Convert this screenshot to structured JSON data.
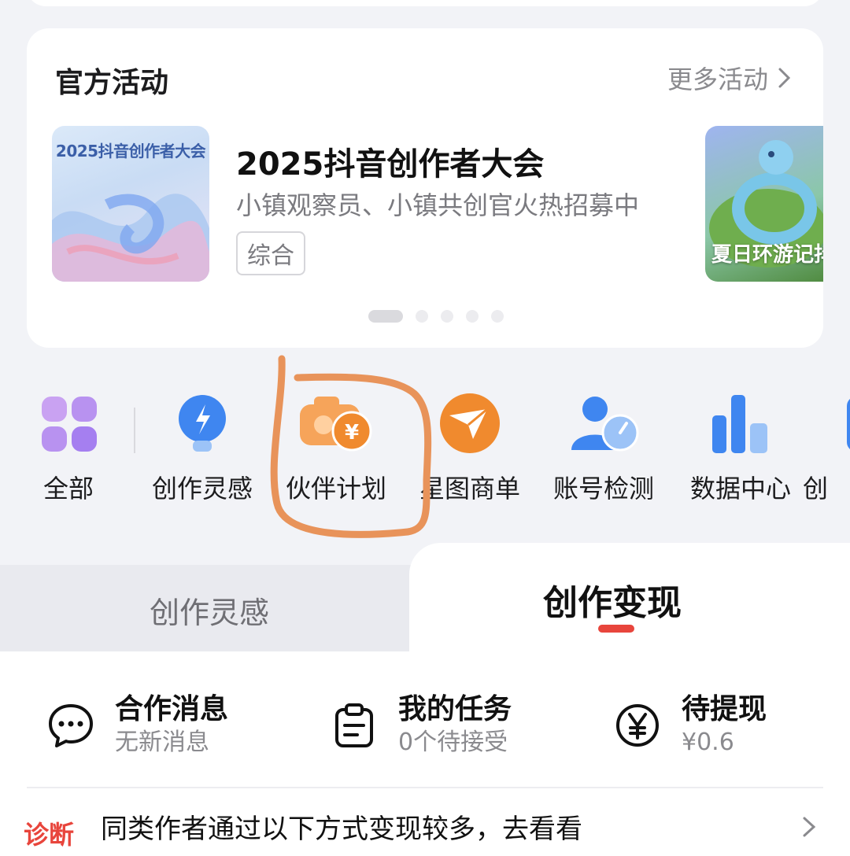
{
  "activity": {
    "title": "官方活动",
    "more_label": "更多活动",
    "banner": {
      "thumb_title": "2025抖音创作者大会",
      "title": "2025抖音创作者大会",
      "subtitle": "小镇观察员、小镇共创官火热招募中",
      "tag": "综合"
    },
    "next_banner_caption": "夏日环游记抖",
    "pagination": {
      "count": 5,
      "active": 0
    }
  },
  "tools": [
    {
      "label": "全部",
      "icon": "grid-icon"
    },
    {
      "label": "创作灵感",
      "icon": "lightbulb-icon"
    },
    {
      "label": "伙伴计划",
      "icon": "camera-coin-icon"
    },
    {
      "label": "星图商单",
      "icon": "star-map-icon"
    },
    {
      "label": "账号检测",
      "icon": "account-check-icon"
    },
    {
      "label": "数据中心",
      "icon": "bar-chart-icon"
    },
    {
      "label": "创",
      "icon": "partial-tool-icon"
    }
  ],
  "tabs": {
    "inactive": "创作灵感",
    "active": "创作变现"
  },
  "stats": [
    {
      "title": "合作消息",
      "sub": "无新消息",
      "icon": "chat-bubble-icon"
    },
    {
      "title": "我的任务",
      "sub": "0个待接受",
      "icon": "clipboard-icon"
    },
    {
      "title": "待提现",
      "sub": "¥0.6",
      "icon": "yen-circle-icon"
    }
  ],
  "tip": {
    "badge": "诊断",
    "text": "同类作者通过以下方式变现较多，去看看"
  },
  "colors": {
    "accent_red": "#e8453c",
    "annotation_orange": "#e8935a",
    "tool_blue": "#3f86f0",
    "tool_orange": "#f08a2e"
  }
}
